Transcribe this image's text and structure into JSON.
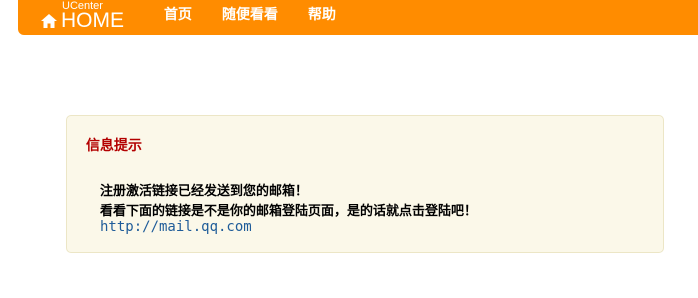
{
  "header": {
    "logo_top": "UCenter",
    "logo_main": "HOME",
    "logo_icon": "home-icon",
    "nav": [
      {
        "label": "首页"
      },
      {
        "label": "随便看看"
      },
      {
        "label": "帮助"
      }
    ]
  },
  "message": {
    "title": "信息提示",
    "line1": "注册激活链接已经发送到您的邮箱！",
    "line2": "看看下面的链接是不是你的邮箱登陆页面，是的话就点击登陆吧！",
    "link": "http://mail.qq.com"
  },
  "colors": {
    "header_bg": "#ff8c00",
    "title_color": "#b30000",
    "link_color": "#1f5c99",
    "box_bg": "#fbf8e9"
  }
}
